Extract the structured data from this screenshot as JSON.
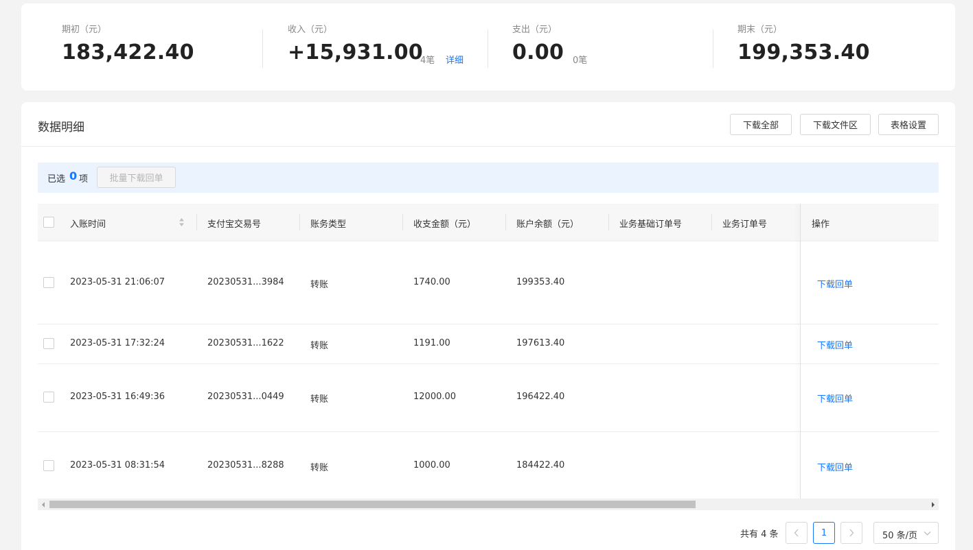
{
  "summary": {
    "opening": {
      "label": "期初（元）",
      "value": "183,422.40"
    },
    "income": {
      "label": "收入（元）",
      "value": "+15,931.00",
      "count": "4笔",
      "detail_link": "详细"
    },
    "expense": {
      "label": "支出（元）",
      "value": "0.00",
      "count": "0笔"
    },
    "closing": {
      "label": "期末（元）",
      "value": "199,353.40"
    }
  },
  "detail": {
    "title": "数据明细",
    "buttons": {
      "download_all": "下载全部",
      "download_area": "下载文件区",
      "table_settings": "表格设置"
    }
  },
  "selection": {
    "prefix": "已选",
    "count": "0",
    "suffix": "项",
    "batch_button": "批量下载回单"
  },
  "table": {
    "columns": {
      "time": "入账时间",
      "trade_no": "支付宝交易号",
      "type": "账务类型",
      "amount": "收支金额（元）",
      "balance": "账户余额（元）",
      "base_order": "业务基础订单号",
      "order": "业务订单号",
      "action": "操作"
    },
    "rows": [
      {
        "time": "2023-05-31 21:06:07",
        "trade_no": "20230531...3984",
        "type": "转账",
        "amount": "1740.00",
        "balance": "199353.40",
        "action": "下载回单"
      },
      {
        "time": "2023-05-31 17:32:24",
        "trade_no": "20230531...1622",
        "type": "转账",
        "amount": "1191.00",
        "balance": "197613.40",
        "action": "下载回单"
      },
      {
        "time": "2023-05-31 16:49:36",
        "trade_no": "20230531...0449",
        "type": "转账",
        "amount": "12000.00",
        "balance": "196422.40",
        "action": "下载回单"
      },
      {
        "time": "2023-05-31 08:31:54",
        "trade_no": "20230531...8288",
        "type": "转账",
        "amount": "1000.00",
        "balance": "184422.40",
        "action": "下载回单"
      }
    ]
  },
  "pagination": {
    "total": "共有 4 条",
    "current_page": "1",
    "page_size": "50 条/页"
  },
  "colors": {
    "accent": "#1677ff",
    "selection_bar": "#ebf3fe"
  }
}
